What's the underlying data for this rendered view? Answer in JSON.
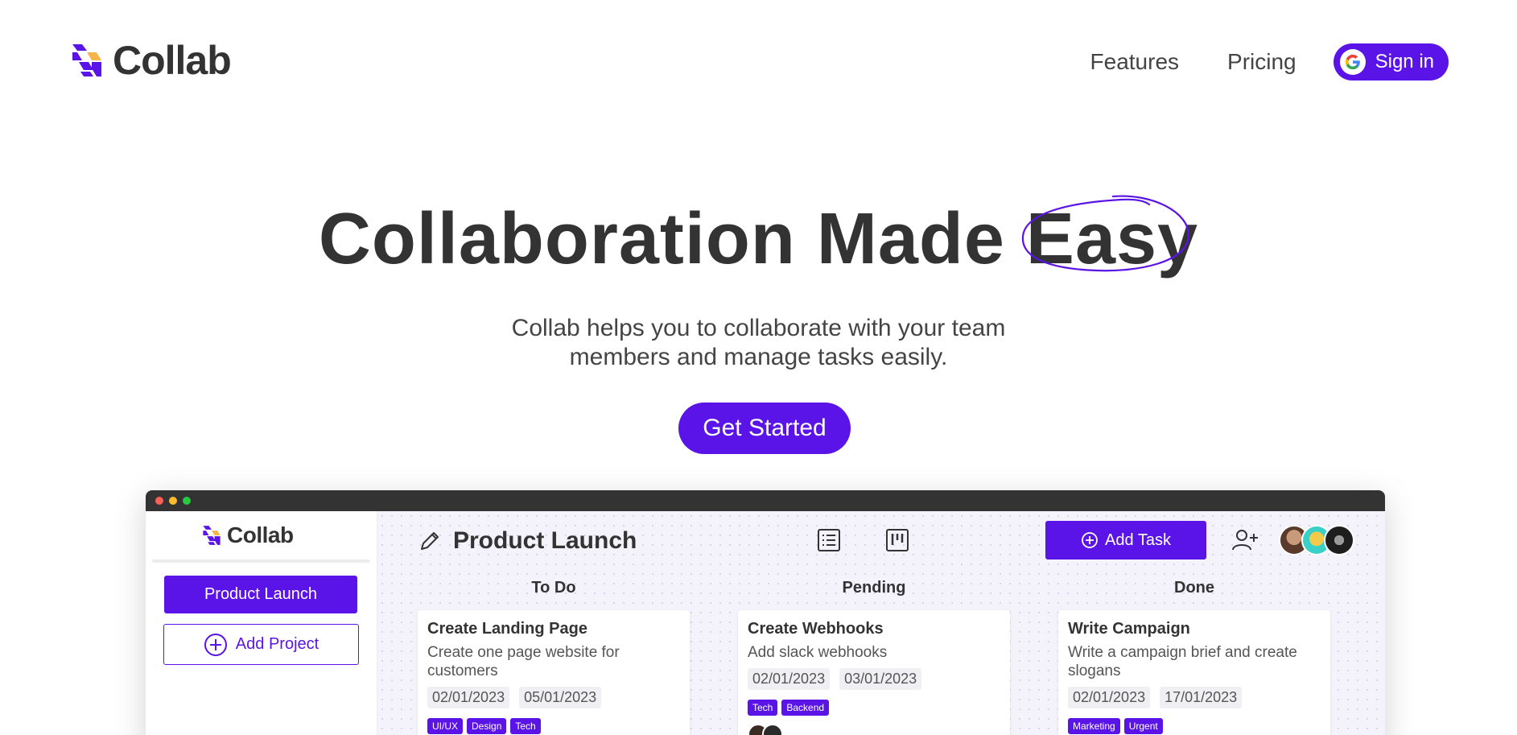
{
  "brand": {
    "name": "Collab"
  },
  "nav": {
    "links": [
      "Features",
      "Pricing"
    ],
    "signin_label": "Sign in"
  },
  "hero": {
    "title_main": "Collaboration Made ",
    "title_highlight": "Easy",
    "subtitle_line1": "Collab helps you to collaborate with your team",
    "subtitle_line2": "members and manage tasks easily.",
    "cta_label": "Get Started"
  },
  "colors": {
    "accent": "#5b14e8",
    "text": "#333333",
    "board_bg": "#f4f2fb"
  },
  "app": {
    "brand": "Collab",
    "sidebar": {
      "active_project": "Product Launch",
      "add_project_label": "Add Project"
    },
    "board": {
      "title": "Product Launch",
      "add_task_label": "Add Task",
      "icons": [
        "edit-pencil-icon",
        "list-view-icon",
        "board-view-icon",
        "add-member-icon"
      ],
      "columns": [
        {
          "title": "To Do",
          "card": {
            "title": "Create Landing Page",
            "description": "Create one page website for customers",
            "start_date": "02/01/2023",
            "end_date": "05/01/2023",
            "tags": [
              "UI/UX",
              "Design",
              "Tech"
            ]
          }
        },
        {
          "title": "Pending",
          "card": {
            "title": "Create Webhooks",
            "description": "Add slack webhooks",
            "start_date": "02/01/2023",
            "end_date": "03/01/2023",
            "tags": [
              "Tech",
              "Backend"
            ]
          }
        },
        {
          "title": "Done",
          "card": {
            "title": "Write Campaign",
            "description": "Write a campaign brief and create slogans",
            "start_date": "02/01/2023",
            "end_date": "17/01/2023",
            "tags": [
              "Marketing",
              "Urgent"
            ]
          }
        }
      ]
    }
  }
}
